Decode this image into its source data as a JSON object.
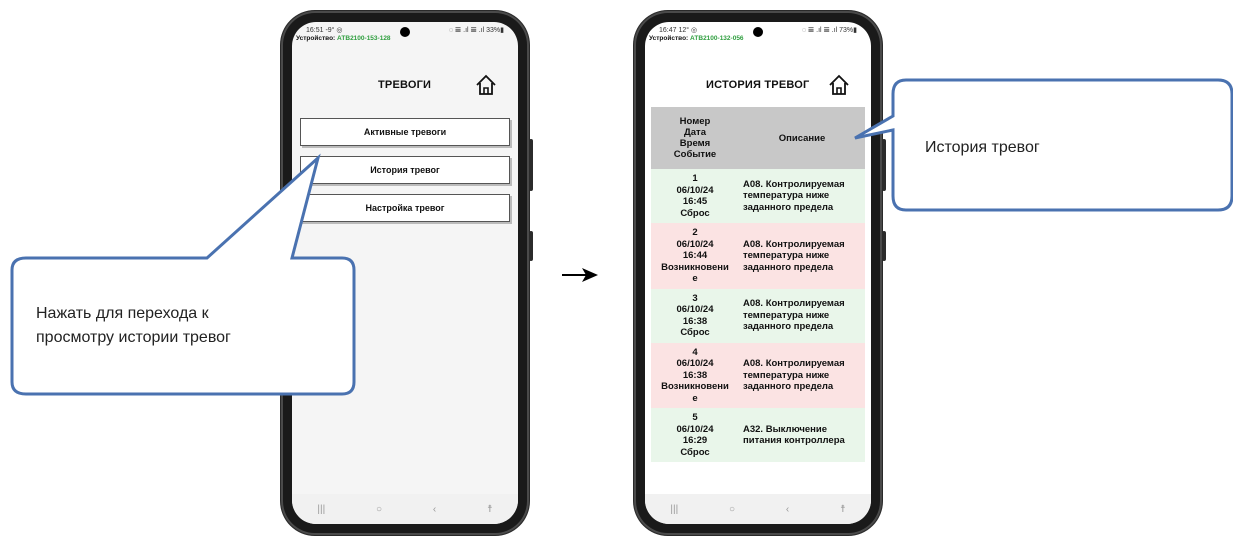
{
  "left_phone": {
    "status_time": "16:51 -9° ◎",
    "status_right": "◌ 𝌆 .ıl 𝌆 .ıl 33%▮",
    "device_label": "Устройство:",
    "device_id": "АТВ2100-153-128",
    "title": "ТРЕВОГИ",
    "buttons": [
      "Активные тревоги",
      "История тревог",
      "Настройка тревог"
    ]
  },
  "right_phone": {
    "status_time": "16:47 12° ◎",
    "status_right": "◌ 𝌆 .ıl 𝌆 .ıl 73%▮",
    "device_label": "Устройство:",
    "device_id": "АТВ2100-132-056",
    "title": "ИСТОРИЯ ТРЕВОГ",
    "table": {
      "header_col1": [
        "Номер",
        "Дата",
        "Время",
        "Событие"
      ],
      "header_col2": "Описание",
      "rows": [
        {
          "num": "1",
          "date": "06/10/24",
          "time": "16:45",
          "event": [
            "Сброс"
          ],
          "desc": "А08. Контролируемая температура ниже заданного предела",
          "kind": "reset"
        },
        {
          "num": "2",
          "date": "06/10/24",
          "time": "16:44",
          "event": [
            "Возникновени",
            "е"
          ],
          "desc": "А08. Контролируемая температура ниже заданного предела",
          "kind": "occur"
        },
        {
          "num": "3",
          "date": "06/10/24",
          "time": "16:38",
          "event": [
            "Сброс"
          ],
          "desc": "А08. Контролируемая температура ниже заданного предела",
          "kind": "reset"
        },
        {
          "num": "4",
          "date": "06/10/24",
          "time": "16:38",
          "event": [
            "Возникновени",
            "е"
          ],
          "desc": "А08. Контролируемая температура ниже заданного предела",
          "kind": "occur"
        },
        {
          "num": "5",
          "date": "06/10/24",
          "time": "16:29",
          "event": [
            "Сброс"
          ],
          "desc": "А32. Выключение питания контроллера",
          "kind": "reset"
        }
      ]
    }
  },
  "callouts": {
    "left_text_line1": "Нажать для перехода к",
    "left_text_line2": "просмотру истории тревог",
    "right_text": "История тревог"
  },
  "navbar_icons": [
    "|||",
    "○",
    "‹",
    "☨"
  ],
  "colors": {
    "callout_border": "#4a72b0",
    "device_id": "#2e9e3e",
    "row_reset": "#e9f6ea",
    "row_occur": "#fbe3e3",
    "table_header": "#c8c8c8"
  }
}
